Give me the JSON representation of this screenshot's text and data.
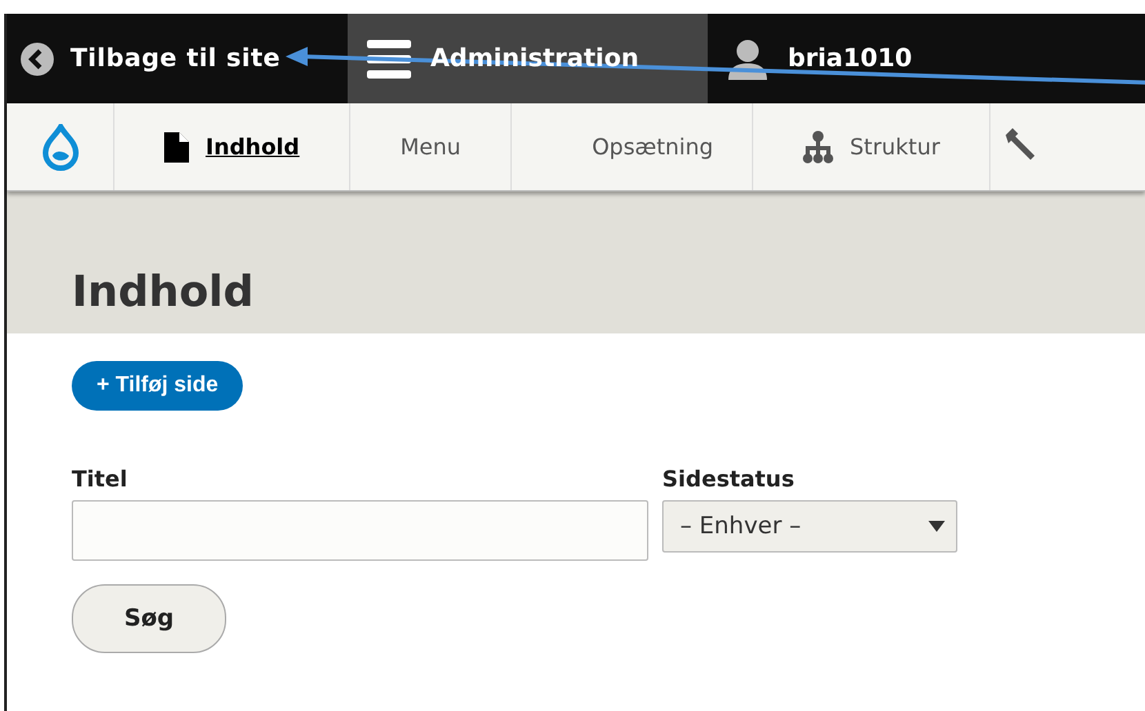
{
  "toolbar": {
    "back_link": "Tilbage til site",
    "tabs": [
      {
        "label": "Administration",
        "selected": true,
        "kind": "menu"
      },
      {
        "label": "bria1010",
        "selected": false,
        "kind": "user"
      }
    ]
  },
  "tray": {
    "items": [
      {
        "label": "Indhold",
        "selected": true,
        "kind": "page"
      },
      {
        "label": "Menu",
        "selected": false,
        "kind": "plain"
      },
      {
        "label": "Opsætning",
        "selected": false,
        "kind": "plain"
      },
      {
        "label": "Struktur",
        "selected": false,
        "kind": "sitemap"
      }
    ]
  },
  "page_title": "Indhold",
  "add_button": "+ Tilføj side",
  "filters": {
    "title": {
      "label": "Titel"
    },
    "status": {
      "label": "Sidestatus",
      "value": "– Enhver –"
    }
  },
  "search_button": "Søg"
}
